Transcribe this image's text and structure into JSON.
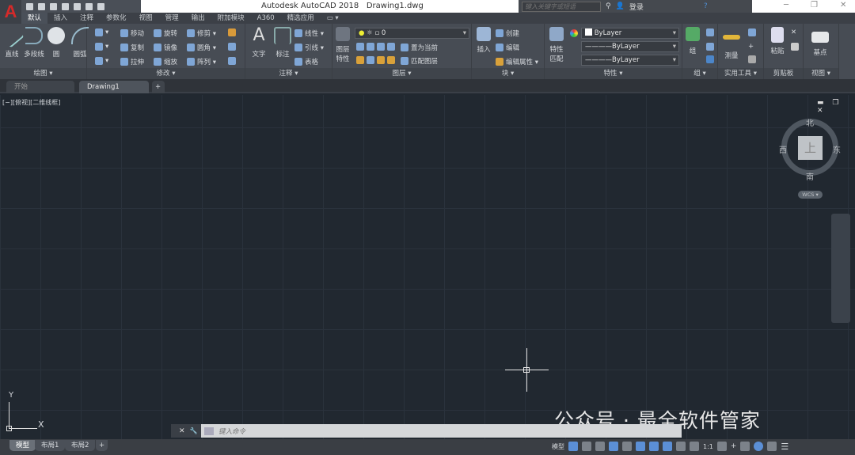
{
  "app": {
    "title": "Autodesk AutoCAD 2018",
    "file": "Drawing1.dwg",
    "logo": "A"
  },
  "search": {
    "placeholder": "键入关键字或短语",
    "login": "登录"
  },
  "window_controls": {
    "minimize": "─",
    "restore": "❐",
    "close": "✕"
  },
  "ribbon_tabs": [
    "默认",
    "插入",
    "注释",
    "参数化",
    "视图",
    "管理",
    "输出",
    "附加模块",
    "A360",
    "精选应用",
    "▭ ▾"
  ],
  "active_tab": "默认",
  "draw": {
    "line": "直线",
    "polyline": "多段线",
    "circle": "圆",
    "arc": "圆弧",
    "label": "绘图 ▾"
  },
  "modify": {
    "move": "移动",
    "rotate": "旋转",
    "trim": "修剪 ▾",
    "copy": "复制",
    "mirror": "镜像",
    "fillet": "圆角 ▾",
    "stretch": "拉伸",
    "scale": "缩放",
    "array": "阵列 ▾",
    "label": "修改 ▾"
  },
  "annotation": {
    "text": "文字",
    "dimension": "标注",
    "linear": "线性 ▾",
    "leader": "引线 ▾",
    "table": "表格",
    "label": "注释 ▾"
  },
  "layers": {
    "properties": "图层特性",
    "current_layer": "0",
    "make_current": "置为当前",
    "match_layer": "匹配图层",
    "label": "图层 ▾"
  },
  "block": {
    "insert": "插入",
    "create": "创建",
    "edit": "编辑",
    "edit_attributes": "编辑属性 ▾",
    "label": "块 ▾"
  },
  "properties": {
    "match": "特性匹配",
    "color": "ByLayer",
    "linetype": "————ByLayer",
    "lineweight": "————ByLayer",
    "label": "特性 ▾"
  },
  "groups": {
    "group": "组",
    "label": "组 ▾"
  },
  "utilities": {
    "measure": "测量",
    "label": "实用工具 ▾"
  },
  "clipboard": {
    "paste": "粘贴",
    "label": "剪贴板"
  },
  "view": {
    "base": "基点",
    "label": "视图 ▾"
  },
  "doc_tabs": [
    "开始",
    "Drawing1"
  ],
  "viewport": {
    "label": "[−][俯视][二维线框]",
    "controls": "▬ ❐ ✕"
  },
  "viewcube": {
    "top": "上",
    "north": "北",
    "south": "南",
    "east": "东",
    "west": "西",
    "wcs": "WCS ▾"
  },
  "ucs": {
    "x": "X",
    "y": "Y"
  },
  "command": {
    "placeholder": "键入命令",
    "close": "✕",
    "settings": "🔧"
  },
  "watermark": "公众号 · 最全软件管家",
  "layout_tabs": [
    "模型",
    "布局1",
    "布局2",
    "+"
  ],
  "status": {
    "model": "模型",
    "annotation_scale": "1:1"
  },
  "colors": {
    "viewport_bg": "#212830",
    "ribbon_bg": "#474c54",
    "accent": "#5b8fd6",
    "logo": "#d42a2a"
  }
}
